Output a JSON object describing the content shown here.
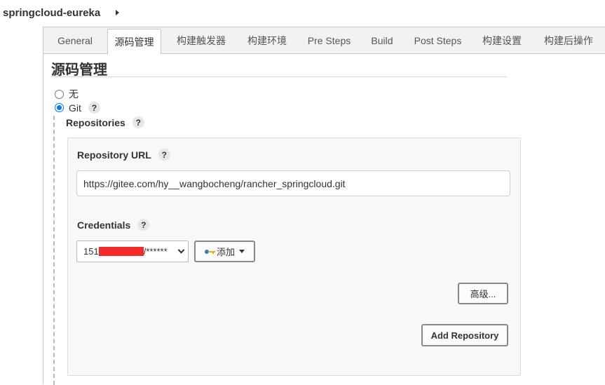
{
  "breadcrumb": {
    "job_name": "springcloud-eureka"
  },
  "tabs": [
    {
      "label": "General",
      "active": false
    },
    {
      "label": "源码管理",
      "active": true
    },
    {
      "label": "构建触发器",
      "active": false
    },
    {
      "label": "构建环境",
      "active": false
    },
    {
      "label": "Pre Steps",
      "active": false
    },
    {
      "label": "Build",
      "active": false
    },
    {
      "label": "Post Steps",
      "active": false
    },
    {
      "label": "构建设置",
      "active": false
    },
    {
      "label": "构建后操作",
      "active": false
    }
  ],
  "scm": {
    "title": "源码管理",
    "options": [
      {
        "label": "无",
        "checked": false
      },
      {
        "label": "Git",
        "checked": true
      }
    ],
    "help_glyph": "?",
    "repositories_label": "Repositories",
    "repository_url_label": "Repository URL",
    "repository_url_value": "https://gitee.com/hy__wangbocheng/rancher_springcloud.git",
    "credentials_label": "Credentials",
    "credentials_selected_prefix": "151",
    "credentials_selected_suffix": "/******",
    "add_button_label": "添加",
    "advanced_button_label": "高级...",
    "add_repository_button_label": "Add Repository"
  },
  "colors": {
    "accent_radio": "#0075ff",
    "redaction": "#f32b2b"
  },
  "icons": {
    "key": "key-icon",
    "help": "help-icon",
    "caret": "caret-down-icon"
  }
}
